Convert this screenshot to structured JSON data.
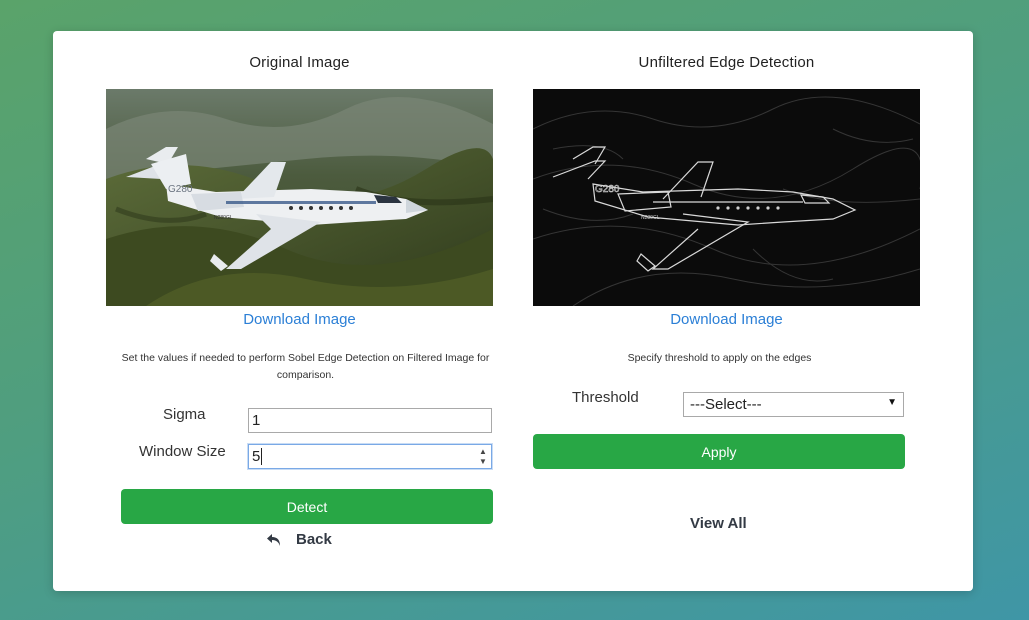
{
  "left_panel": {
    "title": "Original Image",
    "download_label": "Download Image",
    "instruction": "Set the values if needed to perform Sobel Edge Detection on Filtered Image for comparison.",
    "sigma_label": "Sigma",
    "sigma_value": "1",
    "window_size_label": "Window Size",
    "window_size_value": "5",
    "detect_label": "Detect",
    "back_label": "Back",
    "image_tail_text": "G280",
    "image_registration": "N280GL"
  },
  "right_panel": {
    "title": "Unfiltered Edge Detection",
    "download_label": "Download Image",
    "instruction": "Specify threshold to apply on the edges",
    "threshold_label": "Threshold",
    "threshold_selected": "---Select---",
    "apply_label": "Apply",
    "view_all_label": "View All"
  },
  "colors": {
    "accent_green": "#28a745",
    "link_blue": "#2b7fd6"
  },
  "icons": {
    "back": "back-arrow-icon",
    "select_caret": "caret-down-icon",
    "spinner": "spinner-arrows-icon"
  }
}
